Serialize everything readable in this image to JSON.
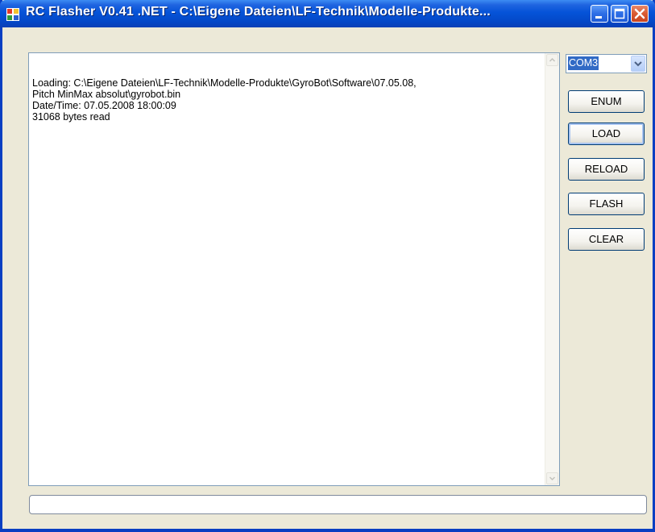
{
  "window": {
    "title": "RC Flasher V0.41 .NET - C:\\Eigene Dateien\\LF-Technik\\Modelle-Produkte..."
  },
  "log": {
    "text": "Loading: C:\\Eigene Dateien\\LF-Technik\\Modelle-Produkte\\GyroBot\\Software\\07.05.08,\nPitch MinMax absolut\\gyrobot.bin\nDate/Time: 07.05.2008 18:00:09\n31068 bytes read"
  },
  "port": {
    "selected": "COM3"
  },
  "buttons": {
    "enum": "ENUM",
    "load": "LOAD",
    "reload": "RELOAD",
    "flash": "FLASH",
    "clear": "CLEAR"
  },
  "progress": {
    "value": 0
  },
  "icons": {
    "app": "rc-flasher-app-icon",
    "minimize": "minimize-icon",
    "maximize": "maximize-icon",
    "close": "close-icon",
    "dropdown": "chevron-down-icon",
    "scroll_up": "scroll-up-arrow-icon",
    "scroll_down": "scroll-down-arrow-icon"
  },
  "colors": {
    "titlebar": "#0553d8",
    "selection": "#316ac5",
    "close_button": "#d95a32"
  }
}
